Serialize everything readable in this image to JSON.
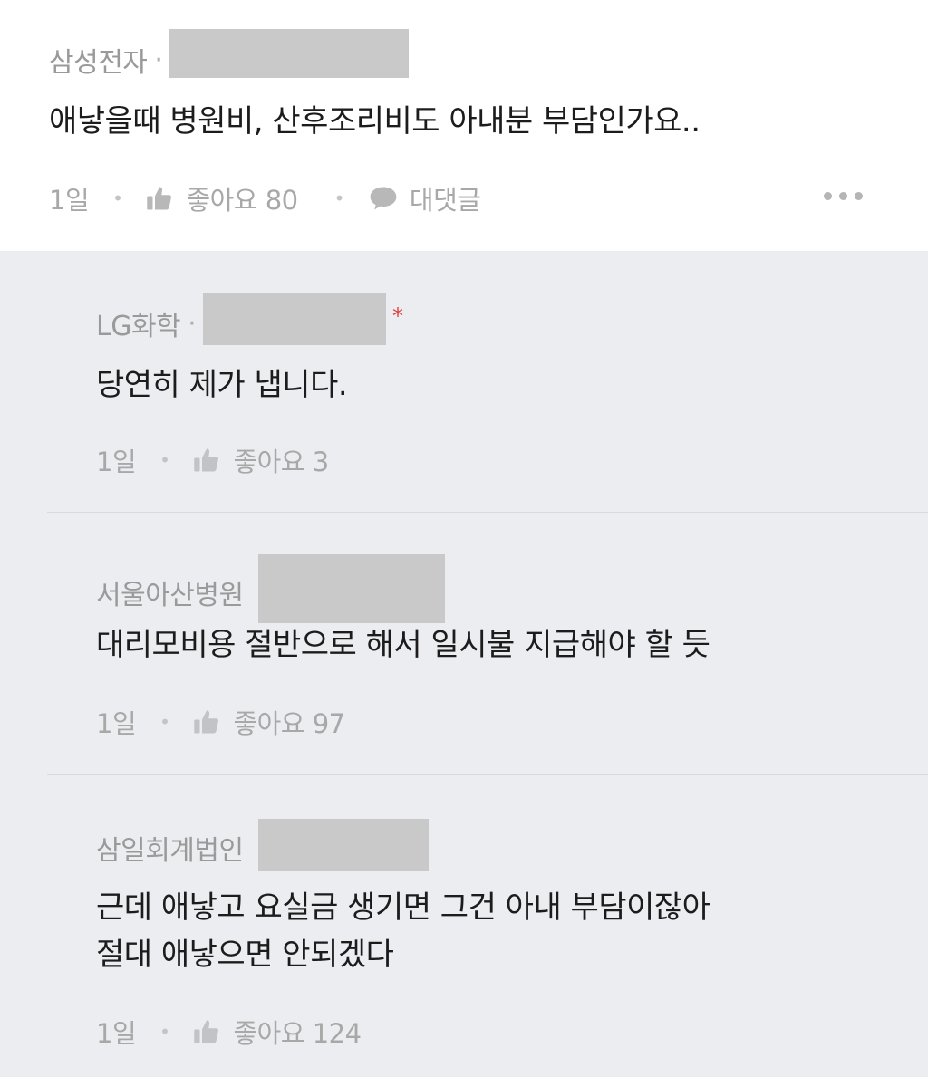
{
  "post": {
    "company": "삼성전자",
    "separator": "·",
    "text": "애낳을때 병원비, 산후조리비도 아내분 부담인가요..",
    "time": "1일",
    "like_label": "좋아요 80",
    "reply_label": "대댓글",
    "icons": {
      "like": "thumbs-up-icon",
      "reply": "speech-bubble-icon",
      "more": "more-dots-icon"
    }
  },
  "replies": [
    {
      "company": "LG화학",
      "separator": "·",
      "text": "당연히 제가 냅니다.",
      "time": "1일",
      "like_label": "좋아요 3",
      "marker": "*"
    },
    {
      "company": "서울아산병원",
      "text": "대리모비용 절반으로 해서 일시불 지급해야 할 듯",
      "time": "1일",
      "like_label": "좋아요 97"
    },
    {
      "company": "삼일회계법인",
      "text_line1": "근데 애낳고 요실금 생기면 그건 아내 부담이잖아",
      "text_line2": "절대 애낳으면 안되겠다",
      "time": "1일",
      "like_label": "좋아요 124"
    }
  ],
  "colors": {
    "post_bg": "#ffffff",
    "reply_bg": "#ecedf1",
    "text": "#1c1c1c",
    "meta": "#a8a8a8",
    "redaction": "#c9c9c9",
    "marker": "#e03a3a"
  }
}
